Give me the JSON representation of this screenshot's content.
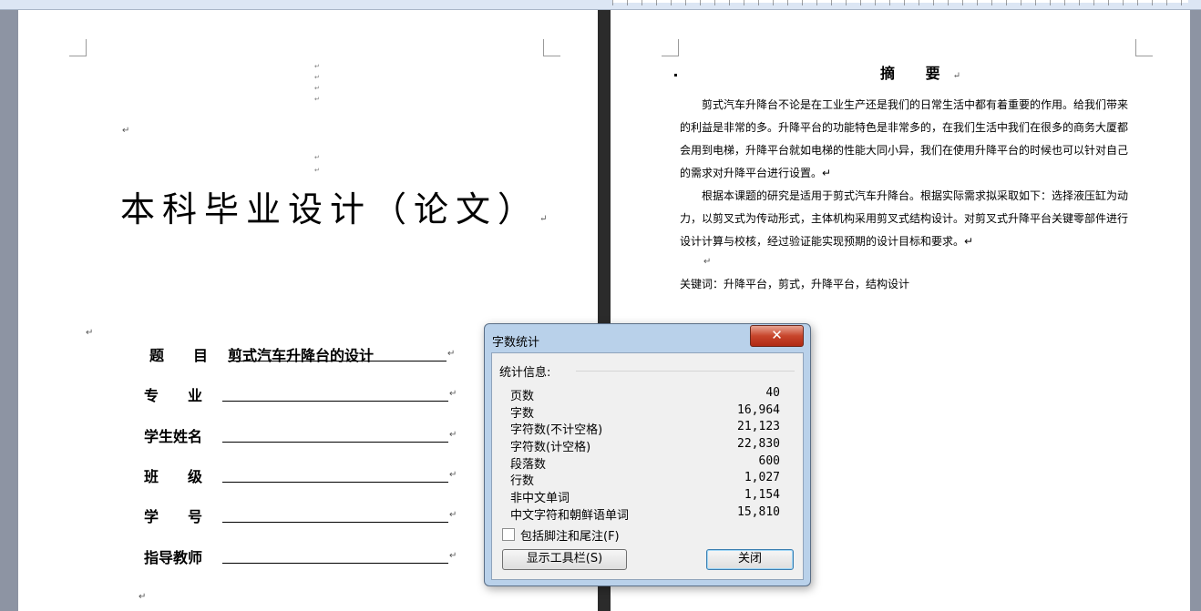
{
  "document": {
    "cover": {
      "title": "本科毕业设计（论文）",
      "fields": [
        {
          "label": "题　　目",
          "value": "剪式汽车升降台的设计"
        },
        {
          "label": "专　　业",
          "value": ""
        },
        {
          "label": "学生姓名",
          "value": ""
        },
        {
          "label": "班　　级",
          "value": ""
        },
        {
          "label": "学　　号",
          "value": ""
        },
        {
          "label": "指导教师",
          "value": ""
        }
      ],
      "para_mark": "↵"
    },
    "abstract": {
      "title": "摘 要",
      "paragraph1": "剪式汽车升降台不论是在工业生产还是我们的日常生活中都有着重要的作用。给我们带来的利益是非常的多。升降平台的功能特色是非常多的，在我们生活中我们在很多的商务大厦都会用到电梯，升降平台就如电梯的性能大同小异，我们在使用升降平台的时候也可以针对自己的需求对升降平台进行设置。↵",
      "paragraph2": "根据本课题的研究是适用于剪式汽车升降台。根据实际需求拟采取如下：选择液压缸为动力，以剪叉式为传动形式，主体机构采用剪叉式结构设计。对剪叉式升降平台关键零部件进行设计计算与校核，经过验证能实现预期的设计目标和要求。↵",
      "keywords": "关键词：升降平台，剪式，升降平台，结构设计"
    }
  },
  "dialog": {
    "title": "字数统计",
    "close_glyph": "✕",
    "group_label": "统计信息:",
    "stats": [
      {
        "label": "页数",
        "value": "40"
      },
      {
        "label": "字数",
        "value": "16,964"
      },
      {
        "label": "字符数(不计空格)",
        "value": "21,123"
      },
      {
        "label": "字符数(计空格)",
        "value": "22,830"
      },
      {
        "label": "段落数",
        "value": "600"
      },
      {
        "label": "行数",
        "value": "1,027"
      },
      {
        "label": "非中文单词",
        "value": "1,154"
      },
      {
        "label": "中文字符和朝鲜语单词",
        "value": "15,810"
      }
    ],
    "checkbox_label": "包括脚注和尾注(F)",
    "checkbox_checked": false,
    "toolbar_button": "显示工具栏(S)",
    "close_button": "关闭"
  }
}
